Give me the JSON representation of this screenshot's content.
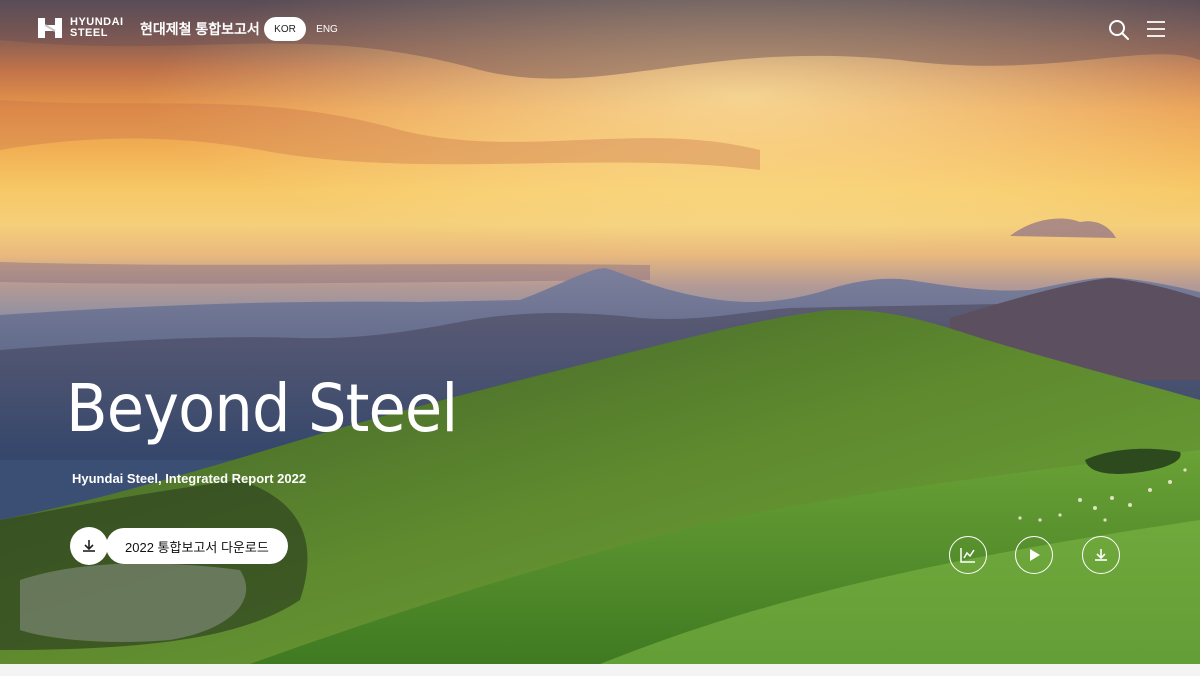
{
  "header": {
    "brand_line1": "HYUNDAI",
    "brand_line2": "STEEL",
    "report_title": "현대제철 통합보고서",
    "lang_active": "KOR",
    "lang_other": "ENG",
    "search_icon": "search-icon",
    "menu_icon": "hamburger-menu-icon"
  },
  "hero": {
    "headline": "Beyond Steel",
    "subline": "Hyundai Steel, Integrated Report 2022",
    "download_label": "2022 통합보고서 다운로드"
  },
  "actions": [
    {
      "icon": "chart-icon"
    },
    {
      "icon": "play-icon"
    },
    {
      "icon": "download-icon"
    }
  ],
  "colors": {
    "text": "#ffffff",
    "pill_bg": "#ffffff",
    "pill_text": "#111111"
  }
}
